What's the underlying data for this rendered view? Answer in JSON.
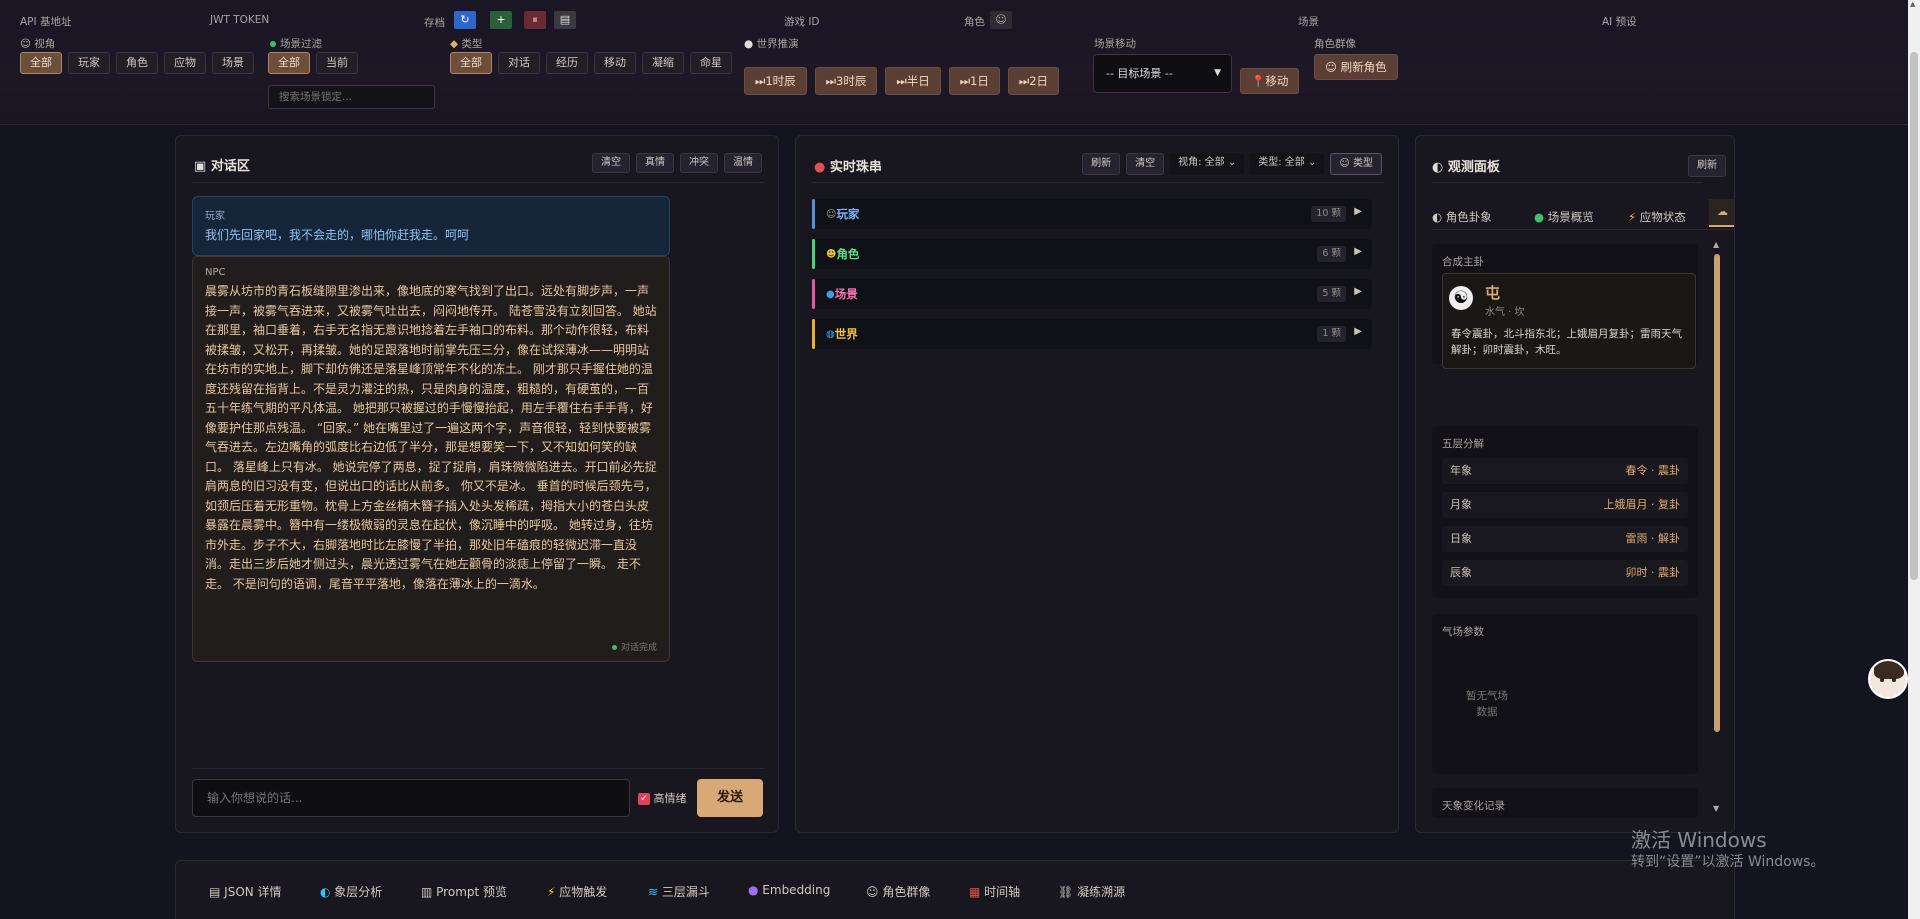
{
  "header": {
    "api_label": "API 基地址",
    "jwt_label": "JWT TOKEN",
    "archive_label": "存档",
    "game_id_label": "游戏 ID",
    "role_label": "角色",
    "scene_label": "场景",
    "ai_label": "AI 预设",
    "perspective": {
      "label": "视角",
      "options": [
        "全部",
        "玩家",
        "角色",
        "应物",
        "场景"
      ]
    },
    "scene_filter": {
      "label": "场景过滤",
      "options": [
        "全部",
        "当前"
      ],
      "search_placeholder": "搜索场景锁定..."
    },
    "type": {
      "label": "类型",
      "options": [
        "全部",
        "对话",
        "经历",
        "移动",
        "凝缩",
        "命星"
      ]
    },
    "world_advance": {
      "label": "世界推演",
      "buttons": [
        "⏭1时辰",
        "⏭3时辰",
        "⏭半日",
        "⏭1日",
        "⏭2日"
      ]
    },
    "scene_move": {
      "label": "场景移动",
      "select_value": "-- 目标场景 --",
      "move_button": "移动"
    },
    "role_group": {
      "label": "角色群像",
      "refresh_button": "刷新角色"
    }
  },
  "dialogue": {
    "title": "对话区",
    "buttons": [
      "清空",
      "真情",
      "冲突",
      "温情"
    ],
    "player_speaker": "玩家",
    "player_text": "我们先回家吧，我不会走的，哪怕你赶我走。呵呵",
    "npc_speaker": "NPC",
    "npc_text": "晨雾从坊市的青石板缝隙里渗出来，像地底的寒气找到了出口。远处有脚步声，一声接一声，被雾气吞进来，又被雾气吐出去，闷闷地传开。 陆苍雪没有立刻回答。 她站在那里，袖口垂着，右手无名指无意识地捻着左手袖口的布料。那个动作很轻，布料被揉皱，又松开，再揉皱。她的足跟落地时前掌先压三分，像在试探薄冰——明明站在坊市的实地上，脚下却仿佛还是落星峰顶常年不化的冻土。 刚才那只手握住她的温度还残留在指背上。不是灵力灌注的热，只是肉身的温度，粗糙的，有硬茧的，一百五十年练气期的平凡体温。 她把那只被握过的手慢慢抬起，用左手覆住右手手背，好像要护住那点残温。 “回家。” 她在嘴里过了一遍这两个字，声音很轻，轻到快要被雾气吞进去。左边嘴角的弧度比右边低了半分，那是想要笑一下，又不知如何笑的缺口。 落星峰上只有冰。 她说完停了两息，捉了捉肩，肩珠微微陷进去。开口前必先捉肩两息的旧习没有变，但说出口的话比从前多。 你又不是冰。 垂首的时候后颈先弓，如颈后压着无形重物。枕骨上方金丝楠木簪子插入处头发稀疏，拇指大小的苍白头皮暴露在晨雾中。簪中有一缕极微弱的灵息在起伏，像沉睡中的呼吸。 她转过身，往坊市外走。步子不大，右脚落地时比左膝慢了半拍，那处旧年磕痕的轻微迟滞一直没消。走出三步后她才侧过头，晨光透过雾气在她左颧骨的淡痣上停留了一瞬。 走不走。 不是问句的语调，尾音平平落地，像落在薄冰上的一滴水。",
    "status": "对话完成",
    "input_placeholder": "输入你想说的话...",
    "high_emotion_label": "高情绪",
    "send_button": "发送"
  },
  "pearls": {
    "title": "实时珠串",
    "refresh": "刷新",
    "clear": "清空",
    "perspective_select": "视角: 全部",
    "type_select": "类型: 全部",
    "type_button": "类型",
    "rows": [
      {
        "label": "玩家",
        "count": "10 颗",
        "color": "#5b8fd8"
      },
      {
        "label": "角色",
        "count": "6 颗",
        "color": "#4fd07a"
      },
      {
        "label": "场景",
        "count": "5 颗",
        "color": "#e05c9c"
      },
      {
        "label": "世界",
        "count": "1 颗",
        "color": "#e8b030"
      }
    ]
  },
  "observe": {
    "title": "观测面板",
    "refresh": "刷新",
    "tabs": [
      "角色卦象",
      "场景概览",
      "应物状态"
    ],
    "main_gua_label": "合成主卦",
    "gua_name": "屯",
    "gua_sub": "水气 · 坎",
    "gua_desc": "春令震卦，北斗指东北；上娥眉月复卦；雷雨天气解卦；卯时震卦，木旺。",
    "layers_label": "五层分解",
    "layers": [
      {
        "k": "年象",
        "v": "春令 · 震卦"
      },
      {
        "k": "月象",
        "v": "上娥眉月 · 复卦"
      },
      {
        "k": "日象",
        "v": "雷雨 · 解卦"
      },
      {
        "k": "辰象",
        "v": "卯时 · 震卦"
      }
    ],
    "weather_label": "气场参数",
    "weather_empty": "暂无气场数据",
    "log_label": "天象变化记录"
  },
  "bottom_tabs": [
    "JSON 详情",
    "象层分析",
    "Prompt 预览",
    "应物触发",
    "三层漏斗",
    "Embedding",
    "角色群像",
    "时间轴",
    "凝练溯源"
  ],
  "watermark": {
    "title": "激活 Windows",
    "sub": "转到“设置”以激活 Windows。"
  }
}
